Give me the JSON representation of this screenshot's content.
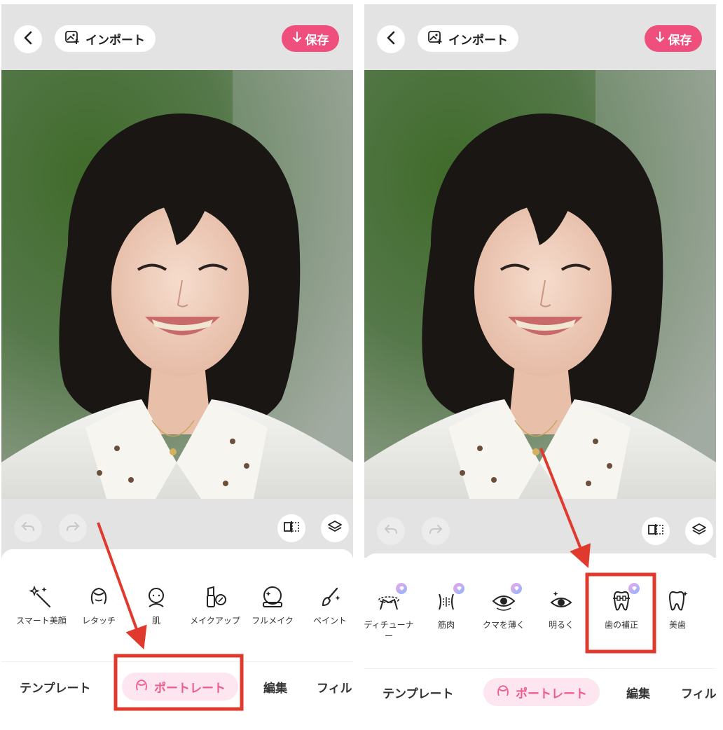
{
  "colors": {
    "accent": "#ee4f7d",
    "annotation": "#e03a2f",
    "active_tab_bg": "#fde6ef",
    "active_tab_text": "#ef5b8b"
  },
  "panels": [
    {
      "topbar": {
        "import_label": "インポート",
        "save_label": "保存"
      },
      "tools": [
        {
          "label": "スマート美顔",
          "icon": "magic-wand-icon"
        },
        {
          "label": "レタッチ",
          "icon": "retouch-face-icon"
        },
        {
          "label": "肌",
          "icon": "skin-face-icon"
        },
        {
          "label": "メイクアップ",
          "icon": "lipstick-icon"
        },
        {
          "label": "フルメイク",
          "icon": "compact-mirror-icon"
        },
        {
          "label": "ペイント",
          "icon": "paint-brush-icon"
        }
      ],
      "tabs": [
        "テンプレート",
        "ポートレート",
        "編集",
        "フィル"
      ]
    },
    {
      "topbar": {
        "import_label": "インポート",
        "save_label": "保存"
      },
      "tools": [
        {
          "label": "ディチューナ",
          "label2": "ー",
          "icon": "body-tuner-icon",
          "premium": true
        },
        {
          "label": "筋肉",
          "icon": "muscle-icon",
          "premium": true
        },
        {
          "label": "クマを薄く",
          "icon": "dark-circle-eye-icon",
          "premium": true
        },
        {
          "label": "明るく",
          "icon": "brighten-eye-icon"
        },
        {
          "label": "歯の補正",
          "icon": "braces-tooth-icon",
          "premium": true
        },
        {
          "label": "美歯",
          "icon": "sparkle-tooth-icon"
        }
      ],
      "tabs": [
        "テンプレート",
        "ポートレート",
        "編集",
        "フィル"
      ]
    }
  ]
}
